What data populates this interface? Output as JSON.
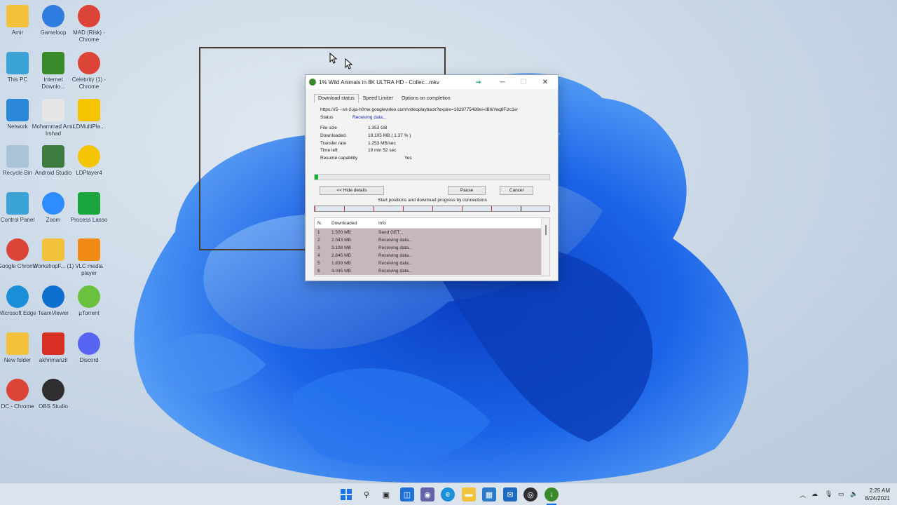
{
  "desktop": {
    "icons": [
      {
        "label": "Amir",
        "icon": "folder-icon",
        "color": "#f2c23a"
      },
      {
        "label": "Gameloop",
        "icon": "gameloop-icon",
        "color": "#2f7de1"
      },
      {
        "label": "MAD (Risk) - Chrome",
        "icon": "chrome-icon",
        "color": "#db4437"
      },
      {
        "label": "This PC",
        "icon": "monitor-icon",
        "color": "#3ba3d6"
      },
      {
        "label": "Internet Downlo...",
        "icon": "idm-icon",
        "color": "#3a8a2c"
      },
      {
        "label": "Celebrity (1) - Chrome",
        "icon": "chrome-icon",
        "color": "#db4437"
      },
      {
        "label": "Network",
        "icon": "network-icon",
        "color": "#2b88d8"
      },
      {
        "label": "Mohammad Amir Irshad",
        "icon": "document-icon",
        "color": "#e6e6e6"
      },
      {
        "label": "LDMultiPla...",
        "icon": "ldmultiplayer-icon",
        "color": "#f5c400"
      },
      {
        "label": "Recycle Bin",
        "icon": "recycle-bin-icon",
        "color": "#a9c3d8"
      },
      {
        "label": "Android Studio",
        "icon": "android-studio-icon",
        "color": "#3d7c3f"
      },
      {
        "label": "LDPlayer4",
        "icon": "ldplayer-icon",
        "color": "#f5c400"
      },
      {
        "label": "Control Panel",
        "icon": "control-panel-icon",
        "color": "#3ba3d6"
      },
      {
        "label": "Zoom",
        "icon": "zoom-icon",
        "color": "#2d8cff"
      },
      {
        "label": "Process Lasso",
        "icon": "process-lasso-icon",
        "color": "#1aa63c"
      },
      {
        "label": "Google Chrome",
        "icon": "chrome-icon",
        "color": "#db4437"
      },
      {
        "label": "WorkshopF... (1)",
        "icon": "folder-icon",
        "color": "#f2c23a"
      },
      {
        "label": "VLC media player",
        "icon": "vlc-icon",
        "color": "#f28a16"
      },
      {
        "label": "Microsoft Edge",
        "icon": "edge-icon",
        "color": "#1b8fd8"
      },
      {
        "label": "TeamViewer",
        "icon": "teamviewer-icon",
        "color": "#0e6fd1"
      },
      {
        "label": "µTorrent",
        "icon": "utorrent-icon",
        "color": "#6ac13f"
      },
      {
        "label": "New folder",
        "icon": "folder-icon",
        "color": "#f2c23a"
      },
      {
        "label": "akhrimanzil",
        "icon": "pdf-icon",
        "color": "#d93025"
      },
      {
        "label": "Discord",
        "icon": "discord-icon",
        "color": "#5865f2"
      },
      {
        "label": "DC - Chrome",
        "icon": "chrome-icon",
        "color": "#db4437"
      },
      {
        "label": "OBS Studio",
        "icon": "obs-icon",
        "color": "#302e31"
      }
    ]
  },
  "idm": {
    "title": "1% Wild Animals in 8K ULTRA HD - Collec...mkv",
    "tabs": [
      "Download status",
      "Speed Limiter",
      "Options on completion"
    ],
    "url": "https://r5---sn-2uja-h0me.googlevideo.com/videoplayback?expire=1629775488ei=IBIkYeq8Fizc1w",
    "status_label": "Status",
    "status_value": "Receiving data...",
    "rows": [
      {
        "k": "File size",
        "v": "1.353 GB"
      },
      {
        "k": "Downloaded",
        "v": "19.105 MB ( 1.37 % )"
      },
      {
        "k": "Transfer rate",
        "v": "1.253 MB/sec"
      },
      {
        "k": "Time left",
        "v": "19 min 52 sec"
      }
    ],
    "resume_label": "Resume capability",
    "resume_value": "Yes",
    "progress_fraction": 0.0137,
    "hide_details": "<< Hide details",
    "pause": "Pause",
    "cancel": "Cancel",
    "conn_caption": "Start positions and download progress by connections",
    "table_headers": [
      "N.",
      "Downloaded",
      "Info"
    ],
    "connections": [
      {
        "n": "1",
        "d": "1.500 MB",
        "i": "Send GET..."
      },
      {
        "n": "2",
        "d": "2.043 MB",
        "i": "Receiving data..."
      },
      {
        "n": "3",
        "d": "3.108 MB",
        "i": "Receiving data..."
      },
      {
        "n": "4",
        "d": "2.845 MB",
        "i": "Receiving data..."
      },
      {
        "n": "5",
        "d": "1.839 MB",
        "i": "Receiving data..."
      },
      {
        "n": "6",
        "d": "3.035 MB",
        "i": "Receiving data..."
      }
    ]
  },
  "taskbar": {
    "apps": [
      "windows-start-icon",
      "search-icon",
      "task-view-icon",
      "widgets-icon",
      "teams-chat-icon",
      "edge-icon",
      "file-explorer-icon",
      "store-icon",
      "mail-icon",
      "obs-icon",
      "idm-icon"
    ],
    "tray": [
      "chevron-up-icon",
      "cloud-icon",
      "microphone-icon",
      "network-icon",
      "speaker-icon"
    ],
    "time": "2:25 AM",
    "date": "8/24/2021"
  }
}
